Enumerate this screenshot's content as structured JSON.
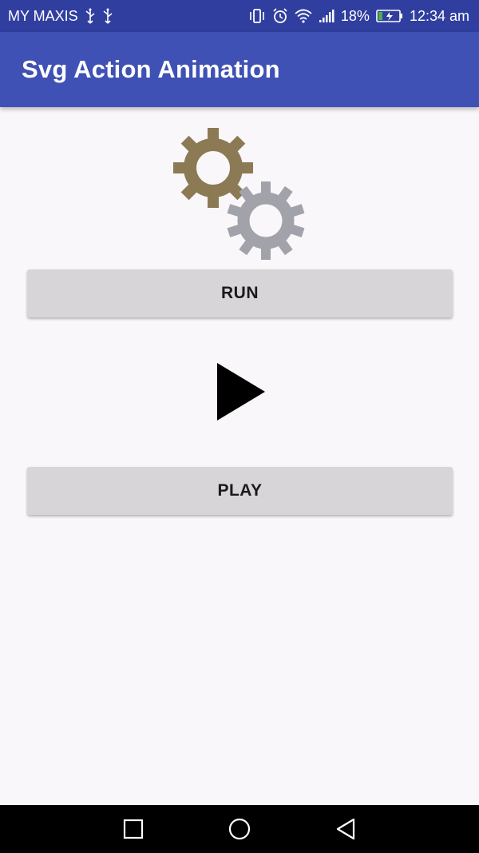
{
  "status_bar": {
    "carrier": "MY MAXIS",
    "battery_percent": "18%",
    "time": "12:34 am",
    "icons": [
      "usb-icon",
      "usb-icon",
      "vibrate-icon",
      "alarm-icon",
      "wifi-icon",
      "signal-icon",
      "battery-charging-icon"
    ]
  },
  "app_bar": {
    "title": "Svg Action Animation"
  },
  "main": {
    "run_button_label": "RUN",
    "play_button_label": "PLAY",
    "gear_colors": {
      "gear_large": "#8c7a55",
      "gear_small": "#a2a2ab"
    },
    "play_icon_color": "#000000"
  },
  "colors": {
    "status_bar": "#303f9f",
    "app_bar": "#3f51b5",
    "button_bg": "#d8d5d8",
    "background": "#faf7fa"
  },
  "nav_bar": {
    "items": [
      "back-icon",
      "home-icon",
      "recent-apps-icon"
    ]
  }
}
